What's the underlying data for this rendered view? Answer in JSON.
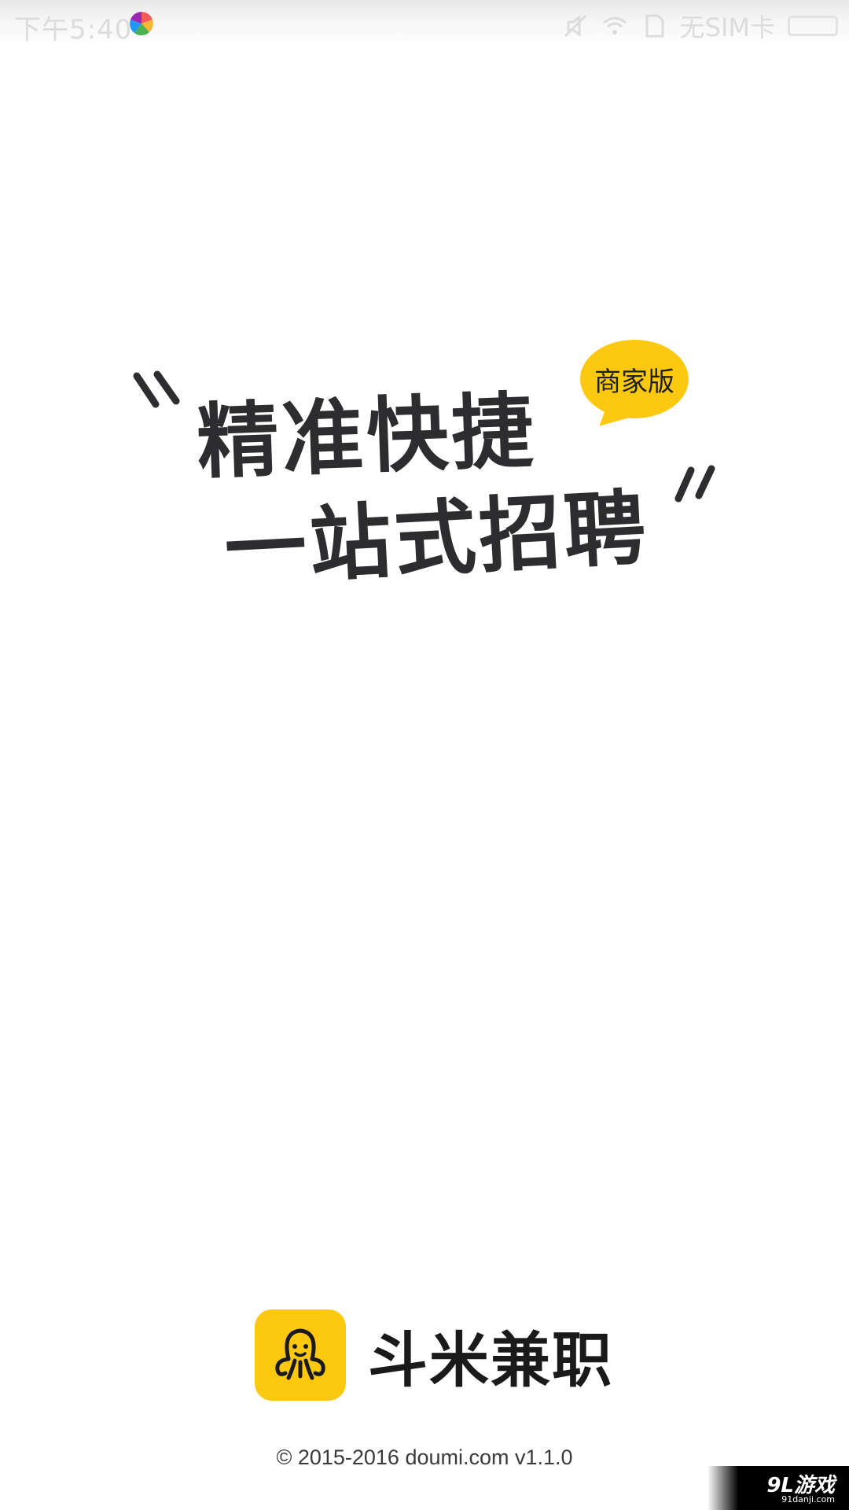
{
  "status_bar": {
    "time": "下午5:40",
    "app_icon": "colorful-pinwheel-icon",
    "icons": [
      "mute-icon",
      "wifi-icon",
      "sim-icon"
    ],
    "sim_text": "无SIM卡",
    "battery_icon": "battery-icon"
  },
  "slogan": {
    "line1": "精准快捷",
    "line2": "一站式招聘",
    "badge": "商家版",
    "badge_color": "#fcc910"
  },
  "brand": {
    "logo_icon": "octopus-icon",
    "name": "斗米兼职",
    "logo_color": "#fcc910"
  },
  "footer": {
    "copyright": "© 2015-2016 doumi.com v1.1.0"
  },
  "watermark": {
    "main": "9L游戏",
    "sub": "91danji.com"
  }
}
